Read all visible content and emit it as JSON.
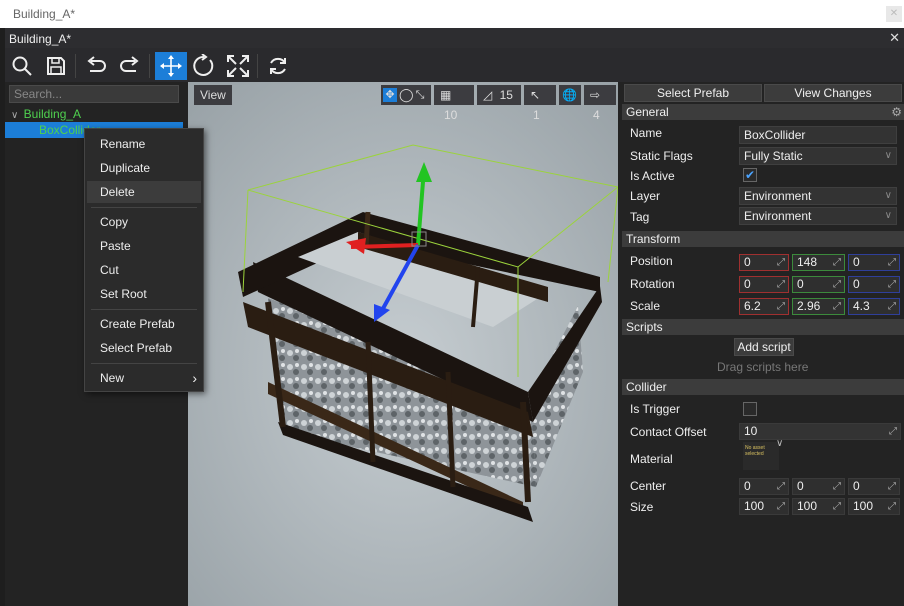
{
  "outer_window": {
    "title": "Building_A*"
  },
  "window": {
    "title": "Building_A*",
    "close": "✕"
  },
  "toolbar": {
    "icons": [
      "search-icon",
      "save-icon",
      "undo-icon",
      "redo-icon",
      "move-gizmo-icon",
      "rotate-gizmo-icon",
      "scale-gizmo-icon",
      "refresh-icon"
    ]
  },
  "tree": {
    "search_placeholder": "Search...",
    "root": "Building_A",
    "child": "BoxCollider"
  },
  "context_menu": {
    "items": [
      "Rename",
      "Duplicate",
      "Delete",
      "Copy",
      "Paste",
      "Cut",
      "Set Root",
      "Create Prefab",
      "Select Prefab",
      "New"
    ],
    "highlighted": "Delete",
    "submenu_arrow": "›"
  },
  "viewport": {
    "view_button": "View",
    "grid_snap": "10",
    "angle_snap": "15",
    "scale_snap": "1",
    "speed": "4"
  },
  "properties": {
    "select_prefab": "Select Prefab",
    "view_changes": "View Changes",
    "general": {
      "header": "General",
      "name_label": "Name",
      "name_value": "BoxCollider",
      "static_label": "Static Flags",
      "static_value": "Fully Static",
      "active_label": "Is Active",
      "active_checked": true,
      "layer_label": "Layer",
      "layer_value": "Environment",
      "tag_label": "Tag",
      "tag_value": "Environment"
    },
    "transform": {
      "header": "Transform",
      "position_label": "Position",
      "position": [
        "0",
        "148",
        "0"
      ],
      "rotation_label": "Rotation",
      "rotation": [
        "0",
        "0",
        "0"
      ],
      "scale_label": "Scale",
      "scale": [
        "6.2",
        "2.96",
        "4.3"
      ]
    },
    "scripts": {
      "header": "Scripts",
      "add_script": "Add script",
      "drag_hint": "Drag scripts here"
    },
    "collider": {
      "header": "Collider",
      "trigger_label": "Is Trigger",
      "trigger_checked": false,
      "offset_label": "Contact Offset",
      "offset_value": "10",
      "material_label": "Material",
      "material_thumb": "No asset selected",
      "center_label": "Center",
      "center": [
        "0",
        "0",
        "0"
      ],
      "size_label": "Size",
      "size": [
        "100",
        "100",
        "100"
      ]
    }
  },
  "colors": {
    "accent": "#1c7ed8",
    "tree_text": "#4fd14f",
    "x_axis": "#e02020",
    "y_axis": "#22c422",
    "z_axis": "#2244ee",
    "collider_wire": "#9bd33c"
  }
}
